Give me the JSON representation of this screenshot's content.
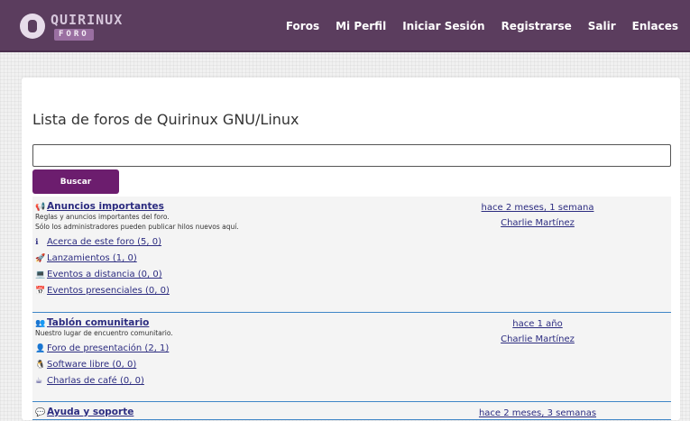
{
  "header": {
    "logo_word": "QUIRINUX",
    "logo_sub": "FORO",
    "nav": [
      "Foros",
      "Mi Perfil",
      "Iniciar Sesión",
      "Registrarse",
      "Salir",
      "Enlaces"
    ]
  },
  "page": {
    "title": "Lista de foros de Quirinux GNU/Linux",
    "search_value": "",
    "search_button": "Buscar"
  },
  "forums": [
    {
      "icon": "megaphone-icon",
      "title": "Anuncios importantes",
      "desc": [
        "Reglas y anuncios importantes del foro.",
        "Sólo los administradores pueden publicar hilos nuevos aquí."
      ],
      "subforums": [
        {
          "icon": "info-icon",
          "label": "Acerca de este foro (5, 0)"
        },
        {
          "icon": "rocket-icon",
          "label": "Lanzamientos (1, 0)"
        },
        {
          "icon": "laptop-icon",
          "label": "Eventos a distancia (0, 0)"
        },
        {
          "icon": "calendar-icon",
          "label": "Eventos presenciales (0, 0)"
        }
      ],
      "last_time": "hace 2 meses, 1 semana",
      "last_user": "Charlie Martínez"
    },
    {
      "icon": "people-icon",
      "title": "Tablón comunitario",
      "desc": [
        "Nuestro lugar de encuentro comunitario."
      ],
      "subforums": [
        {
          "icon": "user-icon",
          "label": "Foro de presentación (2, 1)"
        },
        {
          "icon": "penguin-icon",
          "label": "Software libre (0, 0)"
        },
        {
          "icon": "coffee-icon",
          "label": "Charlas de café (0, 0)"
        }
      ],
      "last_time": "hace 1 año",
      "last_user": "Charlie Martínez"
    },
    {
      "icon": "chat-icon",
      "title": "Ayuda y soporte",
      "desc": [],
      "subforums": [],
      "last_time": "hace 2 meses, 3 semanas",
      "last_user": ""
    }
  ]
}
